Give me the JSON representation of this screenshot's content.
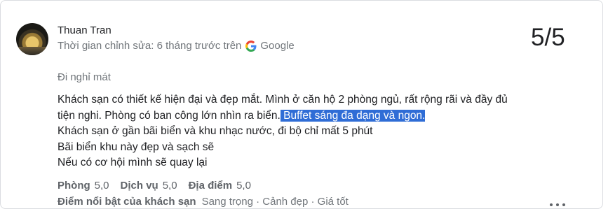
{
  "reviewer": {
    "name": "Thuan Tran",
    "edited_prefix": "Thời gian chỉnh sửa: 6 tháng trước trên",
    "source_label": "Google"
  },
  "score": "5/5",
  "trip_type": "Đi nghỉ mát",
  "review": {
    "line1_part1": "Khách sạn có thiết kế hiện đại và đẹp mắt. Mình ở căn hộ 2 phòng ngủ, rất rộng rãi và đầy đủ tiện nghi. Phòng có ban công lớn nhìn ra biển.",
    "line1_highlight": " Buffet sáng đa dạng và ngon.",
    "line2": "Khách sạn ở gần bãi biển và khu nhạc nước, đi bộ chỉ mất 5 phút",
    "line3": "Bãi biển khu này đẹp và sạch sẽ",
    "line4": "Nếu có cơ hội mình sẽ quay lại"
  },
  "ratings": [
    {
      "label": "Phòng",
      "value": "5,0"
    },
    {
      "label": "Dịch vụ",
      "value": "5,0"
    },
    {
      "label": "Địa điểm",
      "value": "5,0"
    }
  ],
  "highlights": {
    "label": "Điểm nổi bật của khách sạn",
    "values": "Sang trọng · Cảnh đẹp · Giá tốt"
  },
  "icons": {
    "google": "google-logo-icon",
    "more": "more-horizontal-icon"
  },
  "colors": {
    "selection": "#2f6dd6",
    "secondary_text": "#70757a"
  }
}
